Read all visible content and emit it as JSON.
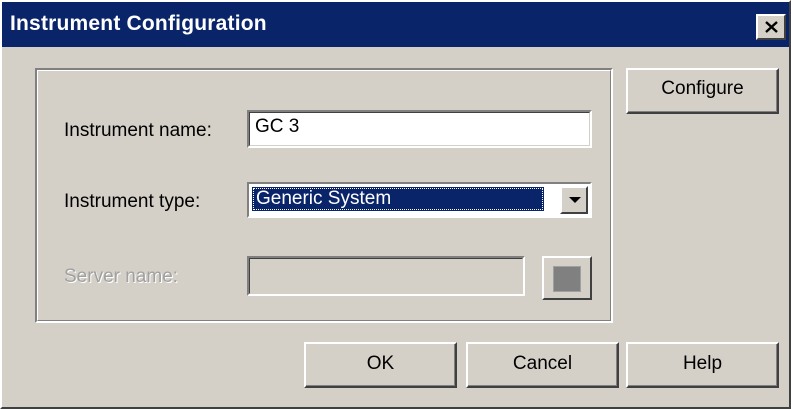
{
  "window": {
    "title": "Instrument Configuration",
    "close_icon": "close-icon"
  },
  "form": {
    "instrument_name_label": "Instrument name:",
    "instrument_name_value": "GC 3",
    "instrument_type_label": "Instrument type:",
    "instrument_type_value": "Generic System",
    "server_name_label": "Server name:",
    "server_name_value": ""
  },
  "buttons": {
    "configure": "Configure",
    "ok": "OK",
    "cancel": "Cancel",
    "help": "Help"
  },
  "colors": {
    "titlebar": "#0a246a",
    "face": "#d4d0c8",
    "selection": "#0a246a"
  }
}
